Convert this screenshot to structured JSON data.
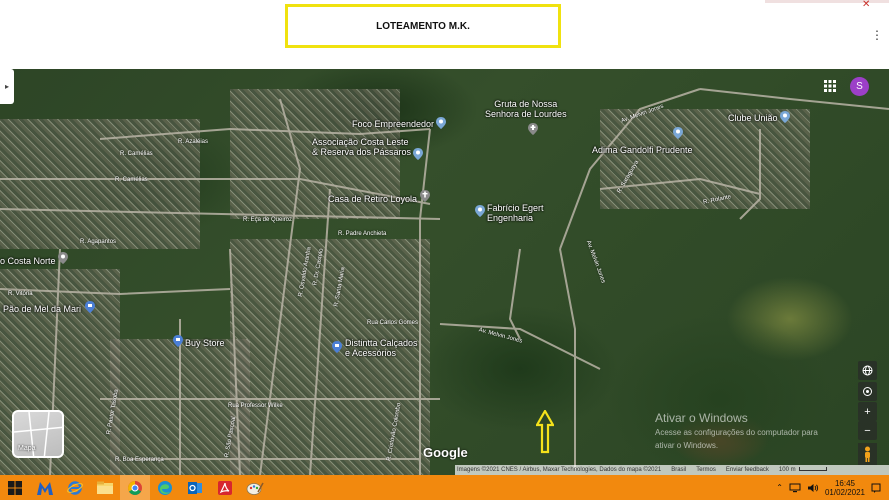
{
  "slide": {
    "title": "LOTEAMENTO M.K."
  },
  "map": {
    "places": [
      {
        "name": "Gruta de Nossa\nSenhora de Lourdes"
      },
      {
        "name": "Foco Empreendedor"
      },
      {
        "name": "Associação Costa Leste\n& Reserva dos Pássaros"
      },
      {
        "name": "Casa de Retiro Loyola"
      },
      {
        "name": "Fabrício Egert\nEngenharia"
      },
      {
        "name": "Adima Gandolfi Prudente"
      },
      {
        "name": "Clube União"
      },
      {
        "name": "o Costa Norte"
      },
      {
        "name": "Pão de Mel da Mari"
      },
      {
        "name": "Buy Store"
      },
      {
        "name": "Distintta Calçados\ne Acessórios"
      }
    ],
    "streets": [
      "R. Azaléias",
      "R. Camélias",
      "R. Camélias",
      "R. Agapantos",
      "R. Eça de Queiroz",
      "R. Padre Anchieta",
      "Av. Melvin Jones",
      "R. Rolante",
      "R. Saraguaya",
      "Av. Melvin Jones",
      "Rua Carlos Gomes",
      "Av. Melvin Jones",
      "R. Vitória",
      "Rua Professor Wilke",
      "R. Boa Esperança",
      "R. Dr. Castelo",
      "R. Santa Maria",
      "R. Osvaldo Aranha",
      "R. Pastor Tasoba",
      "R. São Pascoal",
      "R. Cristóvão Colombo"
    ],
    "layer_toggle_label": "Mapa",
    "google_logo": "Google",
    "attribution": {
      "imagery": "Imagens ©2021 CNES / Airbus, Maxar Technologies, Dados do mapa ©2021",
      "country": "Brasil",
      "terms": "Termos",
      "feedback": "Enviar feedback",
      "scale": "100 m"
    },
    "avatar_letter": "S",
    "controls": {
      "zoom_in": "+",
      "zoom_out": "−"
    }
  },
  "watermark": {
    "title": "Ativar o Windows",
    "line1": "Acesse as configurações do computador para",
    "line2": "ativar o Windows."
  },
  "taskbar": {
    "time": "16:45",
    "date": "01/02/2021",
    "tray_icons": [
      "chevron-up-icon",
      "network-icon",
      "volume-icon"
    ],
    "apps": [
      "start",
      "malwarebytes",
      "internet-explorer",
      "file-explorer",
      "chrome",
      "edge",
      "outlook",
      "acrobat",
      "paint"
    ]
  },
  "colors": {
    "title_border": "#f0e20f",
    "taskbar": "#f2890e",
    "avatar": "#9c3fc8",
    "arrow": "#f5e21b"
  }
}
